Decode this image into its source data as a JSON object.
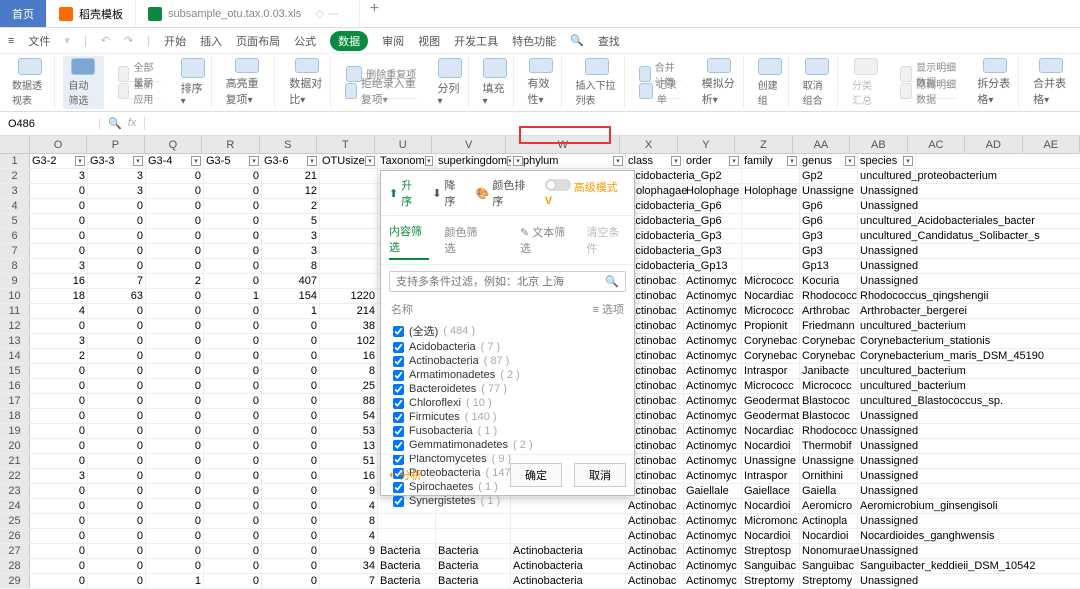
{
  "tabs": {
    "home": "首页",
    "template": "稻壳模板",
    "file": "subsample_otu.tax.0.03.xls",
    "add": "+"
  },
  "menu": {
    "hamburger": "≡",
    "file": "文件",
    "start": "开始",
    "insert": "插入",
    "layout": "页面布局",
    "formula": "公式",
    "data": "数据",
    "review": "审阅",
    "view": "视图",
    "dev": "开发工具",
    "feature": "特色功能",
    "search": "查找"
  },
  "toolbar": {
    "pivot": "数据透视表",
    "autofilter": "自动筛选",
    "showall": "全部显示",
    "reapply": "重新应用",
    "sort": "排序",
    "highlight": "高亮重复项",
    "compare": "数据对比",
    "delrep": "删除重复项",
    "reject": "拒绝录入重复项",
    "split": "分列",
    "fill": "填充",
    "valid": "有效性",
    "dropdown": "插入下拉列表",
    "consol": "合并计算",
    "record": "记录单",
    "sim": "模拟分析",
    "group": "创建组",
    "ungroup": "取消组合",
    "subtotal": "分类汇总",
    "showdetail": "显示明细数据",
    "hidedetail": "隐藏明细数据",
    "splitcell": "拆分表格",
    "mergecell": "合并表格"
  },
  "namebox": "O486",
  "cols": [
    "O",
    "P",
    "Q",
    "R",
    "S",
    "T",
    "U",
    "V",
    "W",
    "X",
    "Y",
    "Z",
    "AA",
    "AB",
    "AC",
    "AD",
    "AE"
  ],
  "hdr": {
    "o": "G3-2",
    "p": "G3-3",
    "q": "G3-4",
    "r": "G3-5",
    "s": "G3-6",
    "t": "OTUsize",
    "u": "Taxonom",
    "v": "superkingdom",
    "w": "phylum",
    "x": "class",
    "y": "order",
    "z": "family",
    "aa": "genus",
    "ab": "species"
  },
  "rows": [
    {
      "n": "2",
      "o": "3",
      "p": "3",
      "q": "0",
      "r": "0",
      "s": "21",
      "x": "Acidobacteria_Gp2",
      "aa": "Gp2",
      "ab": "uncultured_proteobacterium"
    },
    {
      "n": "3",
      "o": "0",
      "p": "3",
      "q": "0",
      "r": "0",
      "s": "12",
      "x": "Holophagae",
      "y": "Holophage",
      "z": "Holophage",
      "aa": "Unassigne",
      "ab": "Unassigned"
    },
    {
      "n": "4",
      "o": "0",
      "p": "0",
      "q": "0",
      "r": "0",
      "s": "2",
      "x": "Acidobacteria_Gp6",
      "aa": "Gp6",
      "ab": "Unassigned"
    },
    {
      "n": "5",
      "o": "0",
      "p": "0",
      "q": "0",
      "r": "0",
      "s": "5",
      "x": "Acidobacteria_Gp6",
      "aa": "Gp6",
      "ab": "uncultured_Acidobacteriales_bacter"
    },
    {
      "n": "6",
      "o": "0",
      "p": "0",
      "q": "0",
      "r": "0",
      "s": "3",
      "x": "Acidobacteria_Gp3",
      "aa": "Gp3",
      "ab": "uncultured_Candidatus_Solibacter_s"
    },
    {
      "n": "7",
      "o": "0",
      "p": "0",
      "q": "0",
      "r": "0",
      "s": "3",
      "x": "Acidobacteria_Gp3",
      "aa": "Gp3",
      "ab": "Unassigned"
    },
    {
      "n": "8",
      "o": "3",
      "p": "0",
      "q": "0",
      "r": "0",
      "s": "8",
      "x": "Acidobacteria_Gp13",
      "aa": "Gp13",
      "ab": "Unassigned"
    },
    {
      "n": "9",
      "o": "16",
      "p": "7",
      "q": "2",
      "r": "0",
      "s": "407",
      "x": "Actinobac",
      "y": "Actinomyc",
      "z": "Micrococc",
      "aa": "Kocuria",
      "ab": "Unassigned"
    },
    {
      "n": "10",
      "o": "18",
      "p": "63",
      "q": "0",
      "r": "1",
      "s": "154",
      "t": "1220",
      "x": "Actinobac",
      "y": "Actinomyc",
      "z": "Nocardiac",
      "aa": "Rhodococc",
      "ab": "Rhodococcus_qingshengii"
    },
    {
      "n": "11",
      "o": "4",
      "p": "0",
      "q": "0",
      "r": "0",
      "s": "1",
      "t": "214",
      "x": "Actinobac",
      "y": "Actinomyc",
      "z": "Micrococc",
      "aa": "Arthrobac",
      "ab": "Arthrobacter_bergerei"
    },
    {
      "n": "12",
      "o": "0",
      "p": "0",
      "q": "0",
      "r": "0",
      "s": "0",
      "t": "38",
      "x": "Actinobac",
      "y": "Actinomyc",
      "z": "Propionit",
      "aa": "Friedmann",
      "ab": "uncultured_bacterium"
    },
    {
      "n": "13",
      "o": "3",
      "p": "0",
      "q": "0",
      "r": "0",
      "s": "0",
      "t": "102",
      "x": "Actinobac",
      "y": "Actinomyc",
      "z": "Corynebac",
      "aa": "Corynebac",
      "ab": "Corynebacterium_stationis"
    },
    {
      "n": "14",
      "o": "2",
      "p": "0",
      "q": "0",
      "r": "0",
      "s": "0",
      "t": "16",
      "x": "Actinobac",
      "y": "Actinomyc",
      "z": "Corynebac",
      "aa": "Corynebac",
      "ab": "Corynebacterium_maris_DSM_45190"
    },
    {
      "n": "15",
      "o": "0",
      "p": "0",
      "q": "0",
      "r": "0",
      "s": "0",
      "t": "8",
      "x": "Actinobac",
      "y": "Actinomyc",
      "z": "Intraspor",
      "aa": "Janibacte",
      "ab": "uncultured_bacterium"
    },
    {
      "n": "16",
      "o": "0",
      "p": "0",
      "q": "0",
      "r": "0",
      "s": "0",
      "t": "25",
      "x": "Actinobac",
      "y": "Actinomyc",
      "z": "Micrococc",
      "aa": "Micrococc",
      "ab": "uncultured_bacterium"
    },
    {
      "n": "17",
      "o": "0",
      "p": "0",
      "q": "0",
      "r": "0",
      "s": "0",
      "t": "88",
      "x": "Actinobac",
      "y": "Actinomyc",
      "z": "Geodermat",
      "aa": "Blastococ",
      "ab": "uncultured_Blastococcus_sp."
    },
    {
      "n": "18",
      "o": "0",
      "p": "0",
      "q": "0",
      "r": "0",
      "s": "0",
      "t": "54",
      "x": "Actinobac",
      "y": "Actinomyc",
      "z": "Geodermat",
      "aa": "Blastococ",
      "ab": "Unassigned"
    },
    {
      "n": "19",
      "o": "0",
      "p": "0",
      "q": "0",
      "r": "0",
      "s": "0",
      "t": "53",
      "x": "Actinobac",
      "y": "Actinomyc",
      "z": "Nocardiac",
      "aa": "Rhodococc",
      "ab": "Unassigned"
    },
    {
      "n": "20",
      "o": "0",
      "p": "0",
      "q": "0",
      "r": "0",
      "s": "0",
      "t": "13",
      "x": "Actinobac",
      "y": "Actinomyc",
      "z": "Nocardioi",
      "aa": "Thermobif",
      "ab": "Unassigned"
    },
    {
      "n": "21",
      "o": "0",
      "p": "0",
      "q": "0",
      "r": "0",
      "s": "0",
      "t": "51",
      "x": "Actinobac",
      "y": "Actinomyc",
      "z": "Unassigne",
      "aa": "Unassigne",
      "ab": "Unassigned"
    },
    {
      "n": "22",
      "o": "3",
      "p": "0",
      "q": "0",
      "r": "0",
      "s": "0",
      "t": "16",
      "x": "Actinobac",
      "y": "Actinomyc",
      "z": "Intraspor",
      "aa": "Ornithini",
      "ab": "Unassigned"
    },
    {
      "n": "23",
      "o": "0",
      "p": "0",
      "q": "0",
      "r": "0",
      "s": "0",
      "t": "9",
      "x": "Actinobac",
      "y": "Gaiellale",
      "z": "Gaiellace",
      "aa": "Gaiella",
      "ab": "Unassigned"
    },
    {
      "n": "24",
      "o": "0",
      "p": "0",
      "q": "0",
      "r": "0",
      "s": "0",
      "t": "4",
      "x": "Actinobac",
      "y": "Actinomyc",
      "z": "Nocardioi",
      "aa": "Aeromicro",
      "ab": "Aeromicrobium_ginsengisoli"
    },
    {
      "n": "25",
      "o": "0",
      "p": "0",
      "q": "0",
      "r": "0",
      "s": "0",
      "t": "8",
      "x": "Actinobac",
      "y": "Actinomyc",
      "z": "Micromonc",
      "aa": "Actinopla",
      "ab": "Unassigned"
    },
    {
      "n": "26",
      "o": "0",
      "p": "0",
      "q": "0",
      "r": "0",
      "s": "0",
      "t": "4",
      "x": "Actinobac",
      "y": "Actinomyc",
      "z": "Nocardioi",
      "aa": "Nocardioi",
      "ab": "Nocardioides_ganghwensis"
    },
    {
      "n": "27",
      "o": "0",
      "p": "0",
      "q": "0",
      "r": "0",
      "s": "0",
      "t": "9",
      "u": "Bacteria",
      "v": "Bacteria",
      "w": "Actinobacteria",
      "x": "Actinobac",
      "y": "Actinomyc",
      "z": "Streptosp",
      "aa": "Nonomurae",
      "ab": "Unassigned"
    },
    {
      "n": "28",
      "o": "0",
      "p": "0",
      "q": "0",
      "r": "0",
      "s": "0",
      "t": "34",
      "u": "Bacteria",
      "v": "Bacteria",
      "w": "Actinobacteria",
      "x": "Actinobac",
      "y": "Actinomyc",
      "z": "Sanguibac",
      "aa": "Sanguibac",
      "ab": "Sanguibacter_keddieii_DSM_10542"
    },
    {
      "n": "29",
      "o": "0",
      "p": "0",
      "q": "1",
      "r": "0",
      "s": "0",
      "t": "7",
      "u": "Bacteria",
      "v": "Bacteria",
      "w": "Actinobacteria",
      "x": "Actinobac",
      "y": "Actinomyc",
      "z": "Streptomy",
      "aa": "Streptomy",
      "ab": "Unassigned"
    }
  ],
  "filter": {
    "asc": "升序",
    "desc": "降序",
    "color": "颜色排序",
    "adv": "高级模式",
    "tab1": "内容筛选",
    "tab2": "颜色筛选",
    "text": "文本筛选",
    "clear": "清空条件",
    "placeholder": "支持多条件过滤，例如：北京 上海",
    "listhead_name": "名称",
    "listhead_opt": "≡ 选项",
    "items": [
      {
        "label": "(全选)",
        "cnt": "( 484 )"
      },
      {
        "label": "Acidobacteria",
        "cnt": "( 7 )"
      },
      {
        "label": "Actinobacteria",
        "cnt": "( 87 )"
      },
      {
        "label": "Armatimonadetes",
        "cnt": "( 2 )"
      },
      {
        "label": "Bacteroidetes",
        "cnt": "( 77 )"
      },
      {
        "label": "Chloroflexi",
        "cnt": "( 10 )"
      },
      {
        "label": "Firmicutes",
        "cnt": "( 140 )"
      },
      {
        "label": "Fusobacteria",
        "cnt": "( 1 )"
      },
      {
        "label": "Gemmatimonadetes",
        "cnt": "( 2 )"
      },
      {
        "label": "Planctomycetes",
        "cnt": "( 9 )"
      },
      {
        "label": "Proteobacteria",
        "cnt": "( 147 )"
      },
      {
        "label": "Spirochaetes",
        "cnt": "( 1 )"
      },
      {
        "label": "Synergistetes",
        "cnt": "( 1 )"
      }
    ],
    "analyze": "分析",
    "ok": "确定",
    "cancel": "取消"
  }
}
